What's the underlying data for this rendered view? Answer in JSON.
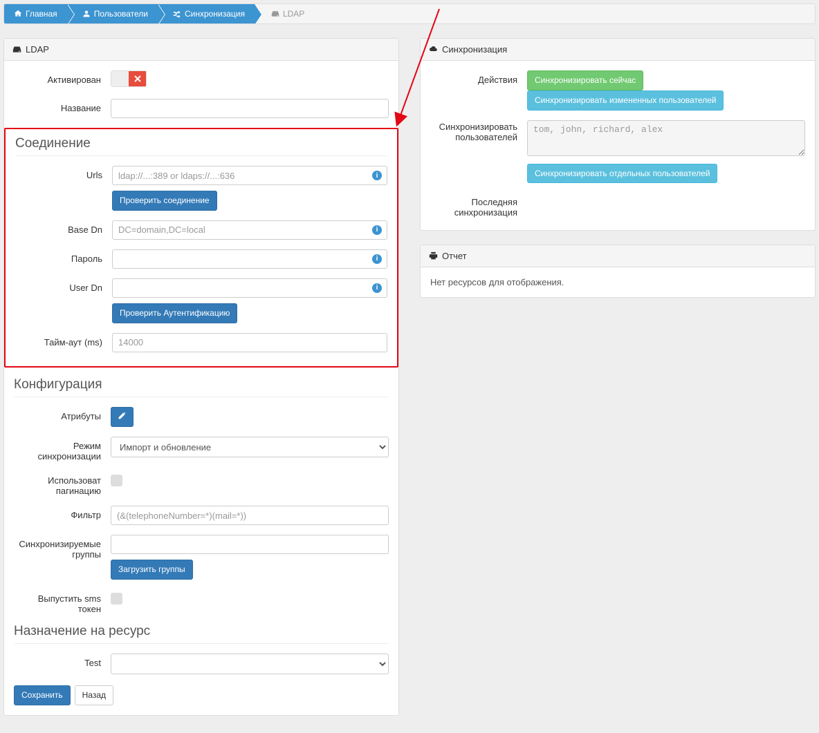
{
  "breadcrumb": {
    "home": "Главная",
    "users": "Пользователи",
    "sync": "Синхронизация",
    "ldap": "LDAP"
  },
  "left": {
    "panel_title": "LDAP",
    "activated_label": "Активирован",
    "name_label": "Название",
    "connection": {
      "title": "Соединение",
      "urls_label": "Urls",
      "urls_placeholder": "ldap://...:389 or ldaps://...:636",
      "test_conn_btn": "Проверить соединение",
      "base_dn_label": "Base Dn",
      "base_dn_placeholder": "DC=domain,DC=local",
      "password_label": "Пароль",
      "user_dn_label": "User Dn",
      "test_auth_btn": "Проверить Аутентификацию",
      "timeout_label": "Тайм-аут (ms)",
      "timeout_placeholder": "14000"
    },
    "config": {
      "title": "Конфигурация",
      "attributes_label": "Атрибуты",
      "sync_mode_label": "Режим синхронизации",
      "sync_mode_value": "Импорт и обновление",
      "use_pagination_label": "Использоват пагинацию",
      "filter_label": "Фильтр",
      "filter_placeholder": "(&(telephoneNumber=*)(mail=*))",
      "sync_groups_label": "Синхронизируемые группы",
      "load_groups_btn": "Загрузить группы",
      "skip_sms_label": "Выпустить sms токен"
    },
    "resource": {
      "title": "Назначение на ресурс",
      "test_label": "Test"
    },
    "save_btn": "Сохранить",
    "back_btn": "Назад"
  },
  "right": {
    "sync_panel_title": "Синхронизация",
    "actions_label": "Действия",
    "sync_now_btn": "Синхронизировать сейчас",
    "sync_changed_btn": "Синхронизировать измененных пользователей",
    "sync_users_label": "Синхронизировать пользователей",
    "sync_users_placeholder": "tom, john, richard, alex",
    "sync_selected_btn": "Синхронизировать отдельных пользователей",
    "last_sync_label": "Последняя синхронизация",
    "report_panel_title": "Отчет",
    "no_resources": "Нет ресурсов для отображения."
  }
}
